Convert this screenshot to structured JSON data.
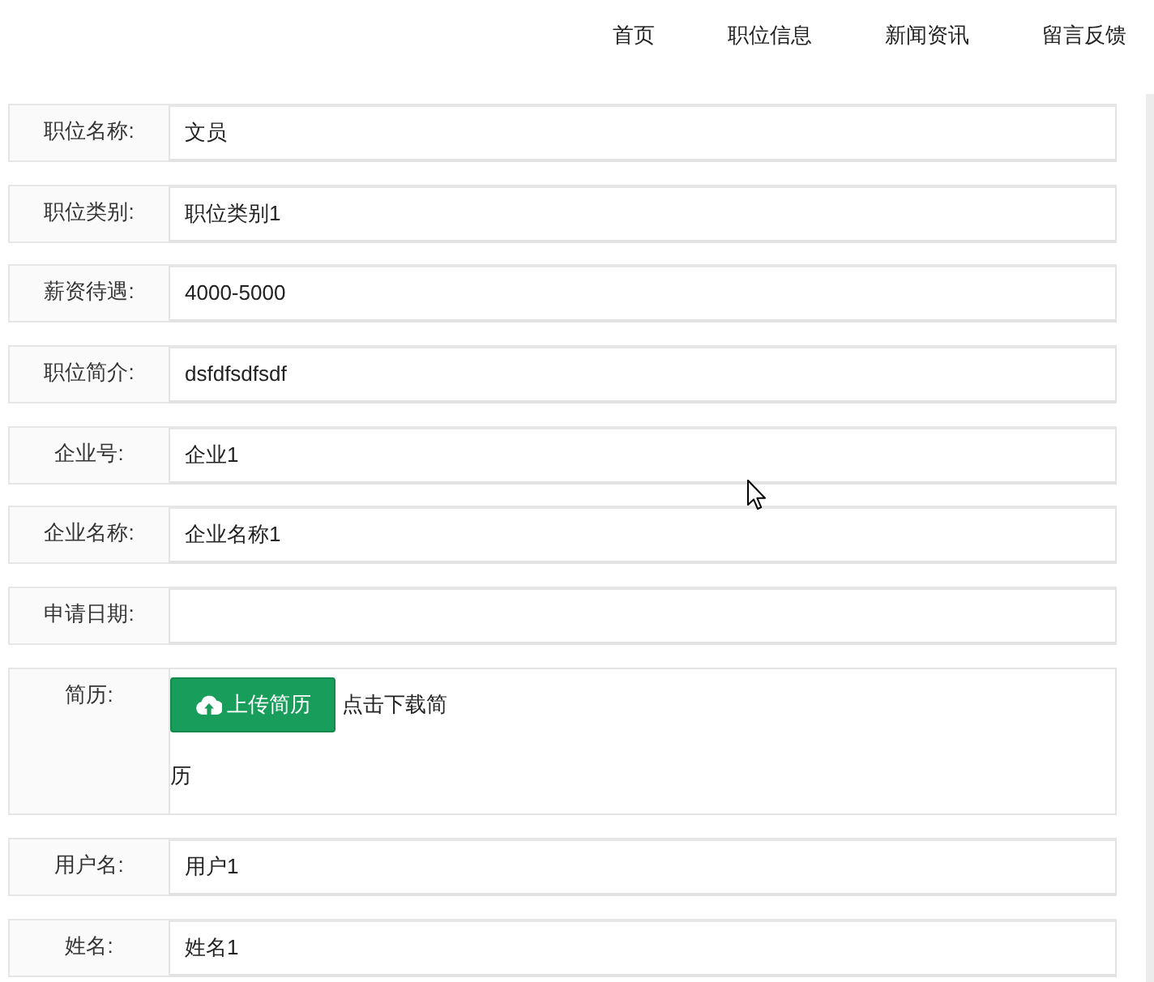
{
  "nav": {
    "items": [
      "首页",
      "职位信息",
      "新闻资讯",
      "留言反馈"
    ]
  },
  "form": {
    "fields": [
      {
        "kind": "text",
        "label": "职位名称:",
        "value": "文员"
      },
      {
        "kind": "text",
        "label": "职位类别:",
        "value": "职位类别1"
      },
      {
        "kind": "text",
        "label": "薪资待遇:",
        "value": "4000-5000"
      },
      {
        "kind": "text",
        "label": "职位简介:",
        "value": "dsfdfsdfsdf"
      },
      {
        "kind": "text",
        "label": "企业号:",
        "value": "企业1"
      },
      {
        "kind": "text",
        "label": "企业名称:",
        "value": "企业名称1"
      },
      {
        "kind": "text",
        "label": "申请日期:"
      },
      {
        "kind": "upload",
        "label": "简历:",
        "button": "上传简历",
        "link_lines": [
          "点击下载简",
          "历"
        ]
      },
      {
        "kind": "text",
        "label": "用户名:",
        "value": "用户1"
      },
      {
        "kind": "text",
        "label": "姓名:",
        "value": "姓名1"
      }
    ]
  }
}
